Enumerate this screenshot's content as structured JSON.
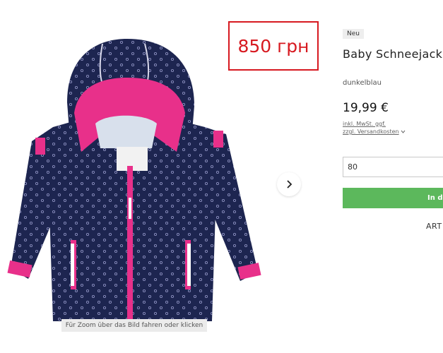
{
  "overlay": {
    "price_stamp": "850 грн"
  },
  "gallery": {
    "zoom_hint": "Für Zoom über das Bild fahren oder klicken",
    "next_icon": "chevron-right-icon"
  },
  "product": {
    "badge": "Neu",
    "title": "Baby Schneejack Allover",
    "color": "dunkelblau",
    "price": "19,99 €",
    "tax_line1": "inkl. MwSt. ggf.",
    "tax_line2": "zzgl. Versandkosten",
    "size_value": "80",
    "cart_label": "In de",
    "art_label": "ART"
  },
  "colors": {
    "stamp_red": "#d71920",
    "jacket_navy": "#1d2550",
    "lining_pink": "#e8308a",
    "cart_green": "#5cb85c"
  }
}
